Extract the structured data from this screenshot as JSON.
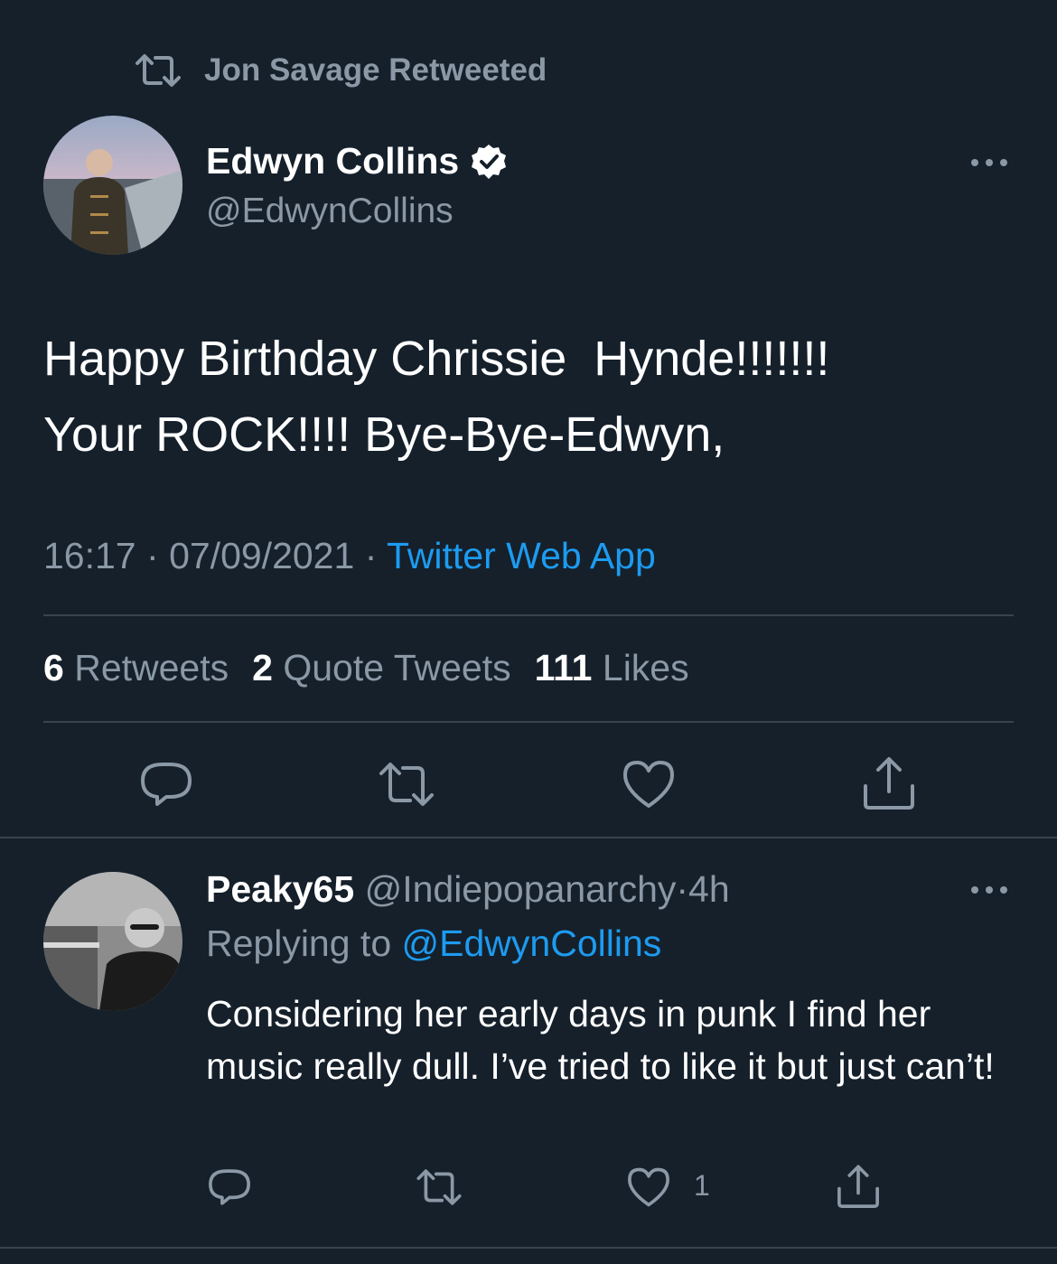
{
  "retweet_header": {
    "text": "Jon Savage Retweeted",
    "icon": "retweet-icon"
  },
  "tweet": {
    "author_name": "Edwyn Collins",
    "author_handle": "@EdwynCollins",
    "verified": true,
    "text_line1": "Happy Birthday Chrissie  Hynde!!!!!!!",
    "text_line2": "Your ROCK!!!! Bye-Bye-Edwyn,",
    "time": "16:17",
    "date": "07/09/2021",
    "separator": "·",
    "source": "Twitter Web App",
    "stats": {
      "retweets_count": "6",
      "retweets_label": "Retweets",
      "quotes_count": "2",
      "quotes_label": "Quote Tweets",
      "likes_count": "111",
      "likes_label": "Likes"
    },
    "actions": [
      "reply-icon",
      "retweet-icon",
      "like-icon",
      "share-icon"
    ]
  },
  "reply": {
    "author_name": "Peaky65",
    "author_handle": "@Indiepopanarchy",
    "separator": "·",
    "age": "4h",
    "replying_label": "Replying to",
    "replying_to": "@EdwynCollins",
    "text": "Considering her early days in punk I find her music really dull. I’ve tried to like it but just can’t!",
    "like_count": "1"
  },
  "colors": {
    "background": "#15202b",
    "muted": "#8b98a5",
    "link": "#1d9bf0",
    "divider": "#38444d",
    "text": "#ffffff"
  }
}
